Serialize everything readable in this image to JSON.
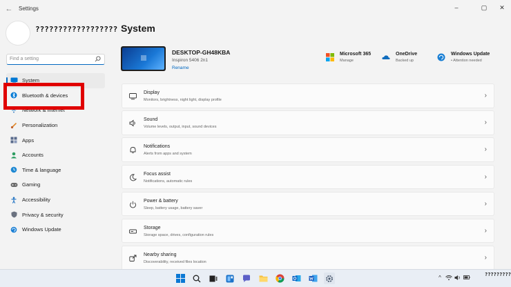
{
  "window": {
    "title": "Settings",
    "back_glyph": "←",
    "controls": [
      "–",
      "▢",
      "✕"
    ]
  },
  "user": {
    "name": "??????????????????"
  },
  "search": {
    "placeholder": "Find a setting"
  },
  "sidebar": {
    "items": [
      {
        "label": "System",
        "icon": "system-icon",
        "color": "#0078d4"
      },
      {
        "label": "Bluetooth & devices",
        "icon": "bluetooth-icon",
        "color": "#0078d4"
      },
      {
        "label": "Network & internet",
        "icon": "network-icon",
        "color": "#3b82c4"
      },
      {
        "label": "Personalization",
        "icon": "brush-icon",
        "color": "#e28a2b"
      },
      {
        "label": "Apps",
        "icon": "apps-icon",
        "color": "#5a6b8c"
      },
      {
        "label": "Accounts",
        "icon": "person-icon",
        "color": "#2e9e62"
      },
      {
        "label": "Time & language",
        "icon": "globe-clock-icon",
        "color": "#1e88d2"
      },
      {
        "label": "Gaming",
        "icon": "gamepad-icon",
        "color": "#6b6b6b"
      },
      {
        "label": "Accessibility",
        "icon": "accessibility-icon",
        "color": "#1a6fc1"
      },
      {
        "label": "Privacy & security",
        "icon": "shield-icon",
        "color": "#6b7280"
      },
      {
        "label": "Windows Update",
        "icon": "update-icon",
        "color": "#1a7fd4"
      }
    ]
  },
  "main": {
    "title": "System",
    "device": {
      "name": "DESKTOP-GH48KBA",
      "model": "Inspiron 5406 2n1",
      "rename": "Rename"
    },
    "quick_links": [
      {
        "title": "Microsoft 365",
        "subtitle": "Manage",
        "icon": "microsoft-365-icon"
      },
      {
        "title": "OneDrive",
        "subtitle": "Backed up",
        "icon": "onedrive-icon"
      },
      {
        "title": "Windows Update",
        "subtitle": "• Attention needed",
        "icon": "windows-update-icon"
      }
    ],
    "cards": [
      {
        "title": "Display",
        "subtitle": "Monitors, brightness, night light, display profile",
        "icon": "display-icon"
      },
      {
        "title": "Sound",
        "subtitle": "Volume levels, output, input, sound devices",
        "icon": "speaker-icon"
      },
      {
        "title": "Notifications",
        "subtitle": "Alerts from apps and system",
        "icon": "bell-icon"
      },
      {
        "title": "Focus assist",
        "subtitle": "Notifications, automatic rules",
        "icon": "moon-icon"
      },
      {
        "title": "Power & battery",
        "subtitle": "Sleep, battery usage, battery saver",
        "icon": "power-icon"
      },
      {
        "title": "Storage",
        "subtitle": "Storage space, drives, configuration rules",
        "icon": "storage-icon"
      },
      {
        "title": "Nearby sharing",
        "subtitle": "Discoverability, received files location",
        "icon": "share-icon"
      }
    ],
    "chevron": "›"
  },
  "taskbar": {
    "apps": [
      "start-icon",
      "search-icon",
      "task-view-icon",
      "widgets-icon",
      "chat-icon",
      "file-explorer-icon",
      "chrome-icon",
      "outlook-icon",
      "word-icon",
      "settings-icon"
    ],
    "tray": [
      "^",
      "wifi",
      "vol",
      "bat"
    ],
    "clock": "????????????"
  },
  "colors": {
    "accent": "#0067c0",
    "highlight": "#e00000"
  }
}
